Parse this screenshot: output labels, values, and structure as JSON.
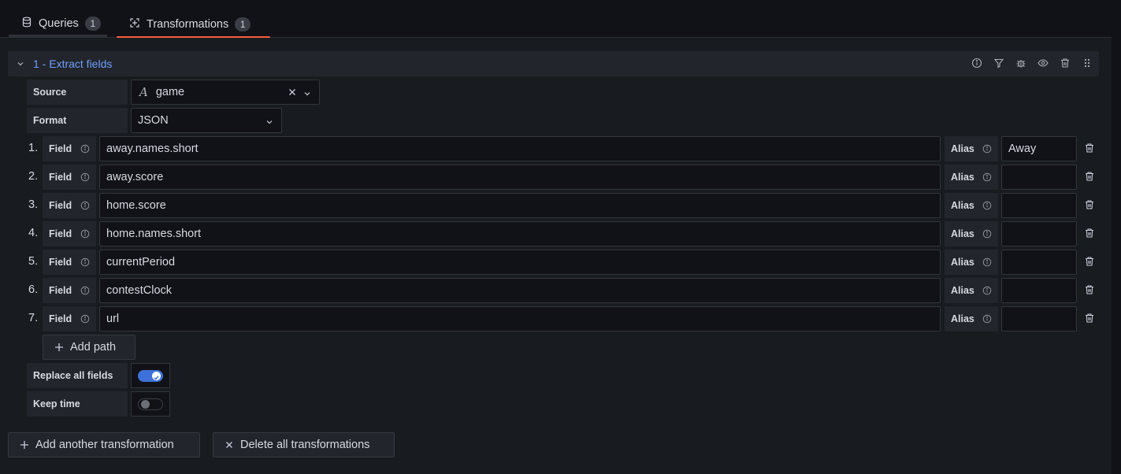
{
  "tabs": [
    {
      "label": "Queries",
      "count": "1",
      "icon": "database-icon"
    },
    {
      "label": "Transformations",
      "count": "1",
      "icon": "transform-icon",
      "active": true
    }
  ],
  "transformation": {
    "title": "1 - Extract fields",
    "header_icons": [
      "info-icon",
      "filter-icon",
      "debug-icon",
      "eye-icon",
      "trash-icon",
      "drag-handle-icon"
    ],
    "source": {
      "label": "Source",
      "value": "game"
    },
    "format": {
      "label": "Format",
      "value": "JSON"
    },
    "paths": [
      {
        "num": "1.",
        "field_label": "Field",
        "path": "away.names.short",
        "alias_label": "Alias",
        "alias": "Away"
      },
      {
        "num": "2.",
        "field_label": "Field",
        "path": "away.score",
        "alias_label": "Alias",
        "alias": ""
      },
      {
        "num": "3.",
        "field_label": "Field",
        "path": "home.score",
        "alias_label": "Alias",
        "alias": ""
      },
      {
        "num": "4.",
        "field_label": "Field",
        "path": "home.names.short",
        "alias_label": "Alias",
        "alias": ""
      },
      {
        "num": "5.",
        "field_label": "Field",
        "path": "currentPeriod",
        "alias_label": "Alias",
        "alias": ""
      },
      {
        "num": "6.",
        "field_label": "Field",
        "path": "contestClock",
        "alias_label": "Alias",
        "alias": ""
      },
      {
        "num": "7.",
        "field_label": "Field",
        "path": "url",
        "alias_label": "Alias",
        "alias": ""
      }
    ],
    "add_path_label": "Add path",
    "replace_all_fields": {
      "label": "Replace all fields",
      "enabled": true
    },
    "keep_time": {
      "label": "Keep time",
      "enabled": false
    }
  },
  "actions": {
    "add_transformation_label": "Add another transformation",
    "delete_all_label": "Delete all transformations"
  },
  "colors": {
    "accent": "#6e9fff",
    "active_tab": "#f55f3e",
    "switch_on": "#3d71d9"
  }
}
